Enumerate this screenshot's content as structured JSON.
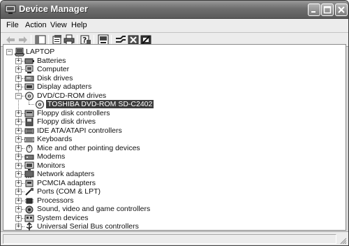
{
  "window": {
    "title": "Device Manager"
  },
  "menu": [
    "File",
    "Action",
    "View",
    "Help"
  ],
  "toolbar": {
    "icons": [
      "back-arrow-icon",
      "forward-arrow-icon",
      "console-tree-icon",
      "properties-icon",
      "print-icon",
      "help-icon",
      "scan-hardware-icon",
      "update-driver-icon",
      "uninstall-icon",
      "disable-icon"
    ]
  },
  "tree": {
    "root": "LAPTOP",
    "categories": [
      {
        "label": "Batteries",
        "icon": "battery-icon",
        "expanded": false
      },
      {
        "label": "Computer",
        "icon": "computer-icon",
        "expanded": false
      },
      {
        "label": "Disk drives",
        "icon": "disk-drive-icon",
        "expanded": false
      },
      {
        "label": "Display adapters",
        "icon": "display-adapter-icon",
        "expanded": false
      },
      {
        "label": "DVD/CD-ROM drives",
        "icon": "dvd-drive-icon",
        "expanded": true,
        "children": [
          "TOSHIBA DVD-ROM SD-C2402"
        ]
      },
      {
        "label": "Floppy disk controllers",
        "icon": "floppy-controller-icon",
        "expanded": false
      },
      {
        "label": "Floppy disk drives",
        "icon": "floppy-drive-icon",
        "expanded": false
      },
      {
        "label": "IDE ATA/ATAPI controllers",
        "icon": "ide-controller-icon",
        "expanded": false
      },
      {
        "label": "Keyboards",
        "icon": "keyboard-icon",
        "expanded": false
      },
      {
        "label": "Mice and other pointing devices",
        "icon": "mouse-icon",
        "expanded": false
      },
      {
        "label": "Modems",
        "icon": "modem-icon",
        "expanded": false
      },
      {
        "label": "Monitors",
        "icon": "monitor-icon",
        "expanded": false
      },
      {
        "label": "Network adapters",
        "icon": "network-adapter-icon",
        "expanded": false
      },
      {
        "label": "PCMCIA adapters",
        "icon": "pcmcia-icon",
        "expanded": false
      },
      {
        "label": "Ports (COM & LPT)",
        "icon": "port-icon",
        "expanded": false
      },
      {
        "label": "Processors",
        "icon": "processor-icon",
        "expanded": false
      },
      {
        "label": "Sound, video and game controllers",
        "icon": "sound-icon",
        "expanded": false
      },
      {
        "label": "System devices",
        "icon": "system-device-icon",
        "expanded": false
      },
      {
        "label": "Universal Serial Bus controllers",
        "icon": "usb-icon",
        "expanded": false
      }
    ]
  },
  "expander": {
    "collapsed": "+",
    "expanded": "−"
  },
  "colors": {
    "selection": "#3c3c3c",
    "titlebar": "#6e6e6e"
  }
}
